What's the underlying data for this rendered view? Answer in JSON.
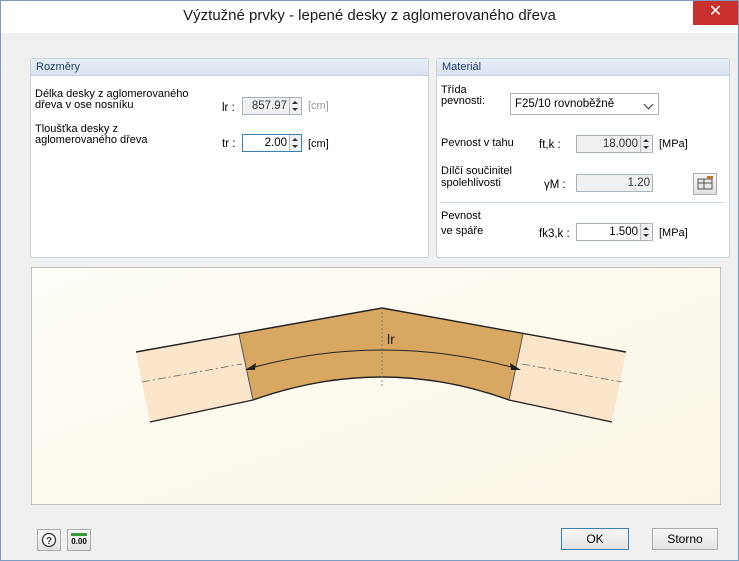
{
  "window": {
    "title": "Výztužné prvky - lepené desky z aglomerovaného dřeva",
    "close_glyph": "✕"
  },
  "dimensions": {
    "header": "Rozměry",
    "length_label_1": "Délka desky z aglomerovaného",
    "length_label_2": "dřeva v ose nosníku",
    "length_symbol": "lr :",
    "length_value": "857.97",
    "length_unit": "[cm]",
    "thickness_label_1": "Tloušťka desky z",
    "thickness_label_2": "aglomerovaného dřeva",
    "thickness_symbol": "tr :",
    "thickness_value": "2.00",
    "thickness_unit": "[cm]"
  },
  "material": {
    "header": "Materiál",
    "class_label_1": "Třída",
    "class_label_2": "pevnosti:",
    "class_value": "F25/10 rovnoběžně",
    "tensile_label": "Pevnost v tahu",
    "tensile_symbol": "ft,k :",
    "tensile_value": "18.000",
    "tensile_unit": "[MPa]",
    "safety_label_1": "Dílčí součinitel",
    "safety_label_2": "spolehlivosti",
    "safety_symbol": "γM :",
    "safety_value": "1.20",
    "joint_label_1": "Pevnost",
    "joint_label_2": "ve spáře",
    "joint_symbol": "fk3,k :",
    "joint_value": "1.500",
    "joint_unit": "[MPa]"
  },
  "drawing": {
    "dimension_label": "lr",
    "beam_color": "#d8a862",
    "end_color": "#fbe6cc"
  },
  "footer": {
    "help_icon": "help-icon",
    "decimal_icon_text": "0.00",
    "ok_label": "OK",
    "cancel_label": "Storno"
  }
}
